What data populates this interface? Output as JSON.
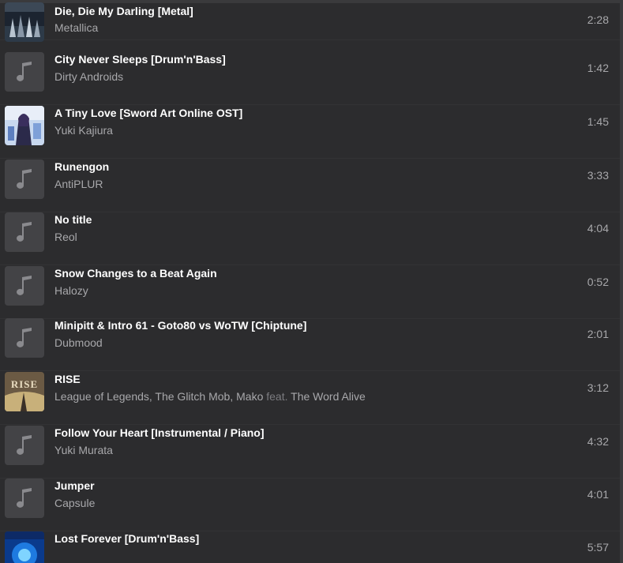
{
  "tracks": [
    {
      "title": "Die, Die My Darling [Metal]",
      "artist": "Metallica",
      "duration": "2:28",
      "art": "metallica"
    },
    {
      "title": "City Never Sleeps [Drum'n'Bass]",
      "artist": "Dirty Androids",
      "duration": "1:42",
      "art": "none"
    },
    {
      "title": "A Tiny Love [Sword Art Online OST]",
      "artist": "Yuki Kajiura",
      "duration": "1:45",
      "art": "anime"
    },
    {
      "title": "Runengon",
      "artist": "AntiPLUR",
      "duration": "3:33",
      "art": "none"
    },
    {
      "title": "No title",
      "artist": "Reol",
      "duration": "4:04",
      "art": "none"
    },
    {
      "title": "Snow Changes to a Beat Again",
      "artist": "Halozy",
      "duration": "0:52",
      "art": "none"
    },
    {
      "title": "Minipitt & Intro 61 - Goto80 vs WoTW [Chiptune]",
      "artist": "Dubmood",
      "duration": "2:01",
      "art": "none"
    },
    {
      "title": "RISE",
      "artist": "League of Legends, The Glitch Mob, Mako",
      "feat_label": "feat.",
      "feat_artist": "The Word Alive",
      "duration": "3:12",
      "art": "rise"
    },
    {
      "title": "Follow Your Heart [Instrumental / Piano]",
      "artist": "Yuki Murata",
      "duration": "4:32",
      "art": "none"
    },
    {
      "title": "Jumper",
      "artist": "Capsule",
      "duration": "4:01",
      "art": "none"
    },
    {
      "title": "Lost Forever [Drum'n'Bass]",
      "artist": "",
      "duration": "5:57",
      "art": "blue"
    }
  ],
  "art_text": {
    "rise": "RISE"
  },
  "icons": {
    "placeholder": "music-note-icon"
  },
  "colors": {
    "background": "#2c2c2e",
    "placeholder": "#434346",
    "title": "#ffffff",
    "secondary": "#a8a8ab"
  }
}
